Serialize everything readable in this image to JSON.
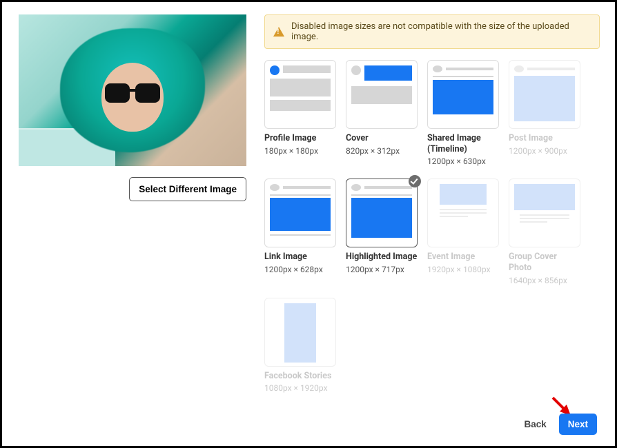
{
  "alert": {
    "message": "Disabled image sizes are not compatible with the size of the uploaded image."
  },
  "buttons": {
    "select_different": "Select Different Image",
    "back": "Back",
    "next": "Next"
  },
  "options": [
    {
      "id": "profile",
      "title": "Profile Image",
      "dims": "180px × 180px",
      "disabled": false,
      "selected": false
    },
    {
      "id": "cover",
      "title": "Cover",
      "dims": "820px × 312px",
      "disabled": false,
      "selected": false
    },
    {
      "id": "shared",
      "title": "Shared Image (Timeline)",
      "dims": "1200px × 630px",
      "disabled": false,
      "selected": false
    },
    {
      "id": "post",
      "title": "Post Image",
      "dims": "1200px × 900px",
      "disabled": true,
      "selected": false
    },
    {
      "id": "link",
      "title": "Link Image",
      "dims": "1200px × 628px",
      "disabled": false,
      "selected": false
    },
    {
      "id": "highlight",
      "title": "Highlighted Image",
      "dims": "1200px × 717px",
      "disabled": false,
      "selected": true
    },
    {
      "id": "event",
      "title": "Event Image",
      "dims": "1920px × 1080px",
      "disabled": true,
      "selected": false
    },
    {
      "id": "groupcover",
      "title": "Group Cover Photo",
      "dims": "1640px × 856px",
      "disabled": true,
      "selected": false
    },
    {
      "id": "stories",
      "title": "Facebook Stories",
      "dims": "1080px × 1920px",
      "disabled": true,
      "selected": false
    }
  ]
}
